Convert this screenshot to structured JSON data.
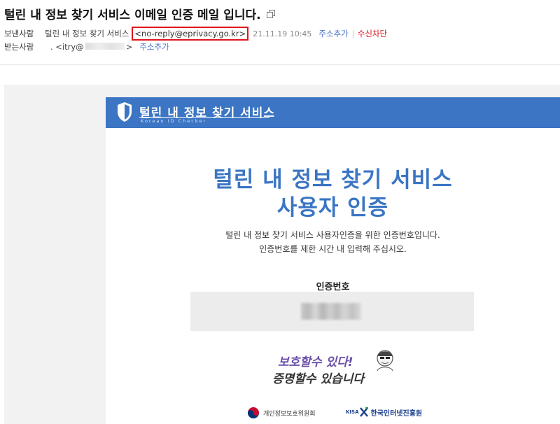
{
  "email": {
    "subject": "털린 내 정보 찾기 서비스 이메일 인증 메일 입니다.",
    "from_label": "보낸사람",
    "sender_name": "털린 내 정보 찾기 서비스",
    "sender_email": "<no-reply@eprivacy.go.kr>",
    "date": "21.11.19 10:45",
    "add_contact_from": "주소추가",
    "block_sender": "수신차단",
    "to_label": "받는사람",
    "recipient_prefix": ". <itry@",
    "recipient_suffix": ">",
    "add_contact_to": "주소추가"
  },
  "body": {
    "banner_title": "털린 내 정보 찾기 서비스",
    "banner_subtitle": "Korean ID Checker",
    "title_line1": "털린 내 정보 찾기 서비스",
    "title_line2": "사용자 인증",
    "desc_line1": "털린 내 정보 찾기 서비스 사용자인증을 위한 인증번호입니다.",
    "desc_line2": "인증번호를 제한 시간 내 입력해 주십시오.",
    "code_label": "인증번호",
    "slogan_line1": "보호할수 있다!",
    "slogan_line2": "증명할수 있습니다",
    "org1": "개인정보보호위원회",
    "org2_kisa": "KISA",
    "org2": "한국인터넷진흥원"
  },
  "colors": {
    "accent": "#3b75c4",
    "block": "#e0141e",
    "link": "#4a72c8"
  }
}
